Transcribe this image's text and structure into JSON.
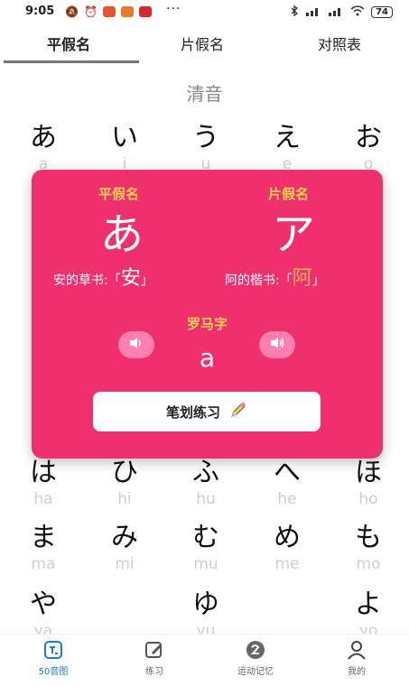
{
  "status_bar": {
    "time": "9:05",
    "more": "···",
    "battery": "74"
  },
  "tabs": [
    {
      "label": "平假名"
    },
    {
      "label": "片假名"
    },
    {
      "label": "对照表"
    }
  ],
  "section_title": "清音",
  "rows": [
    [
      {
        "kana": "あ",
        "romaji": "a"
      },
      {
        "kana": "い",
        "romaji": "i"
      },
      {
        "kana": "う",
        "romaji": "u"
      },
      {
        "kana": "え",
        "romaji": "e"
      },
      {
        "kana": "お",
        "romaji": "o"
      }
    ],
    [
      {
        "kana": "は",
        "romaji": "ha"
      },
      {
        "kana": "ひ",
        "romaji": "hi"
      },
      {
        "kana": "ふ",
        "romaji": "hu"
      },
      {
        "kana": "へ",
        "romaji": "he"
      },
      {
        "kana": "ほ",
        "romaji": "ho"
      }
    ],
    [
      {
        "kana": "ま",
        "romaji": "ma"
      },
      {
        "kana": "み",
        "romaji": "mi"
      },
      {
        "kana": "む",
        "romaji": "mu"
      },
      {
        "kana": "め",
        "romaji": "me"
      },
      {
        "kana": "も",
        "romaji": "mo"
      }
    ],
    [
      {
        "kana": "や",
        "romaji": "ya"
      },
      {
        "kana": "ゆ",
        "romaji": "yu"
      },
      {
        "kana": "よ",
        "romaji": "yo"
      }
    ]
  ],
  "popup": {
    "hiragana_label": "平假名",
    "katakana_label": "片假名",
    "hiragana": "あ",
    "katakana": "ア",
    "hira_origin_label": "安的草书:「",
    "hira_origin_glyph": "安",
    "hira_origin_close": "」",
    "kata_origin_label": "阿的楷书:「",
    "kata_origin_glyph": "阿",
    "kata_origin_close": "」",
    "romaji_label": "罗马字",
    "romaji": "a",
    "stroke_button": "笔划练习",
    "colors": {
      "background": "#f0306c",
      "label": "#ffd34d"
    }
  },
  "bottom_nav": [
    {
      "label": "50音图",
      "icon": "chart-icon",
      "active": true
    },
    {
      "label": "练习",
      "icon": "edit-icon"
    },
    {
      "label": "运动记忆",
      "icon": "memory-icon"
    },
    {
      "label": "我的",
      "icon": "person-icon"
    }
  ]
}
